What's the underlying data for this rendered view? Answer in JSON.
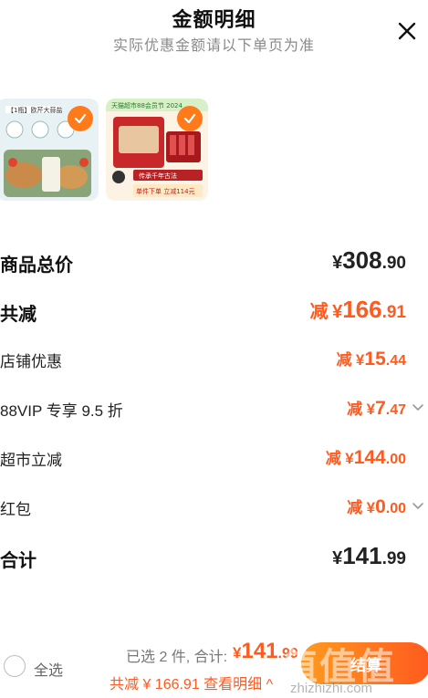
{
  "header": {
    "title": "金额明细",
    "subtitle": "实际优惠金额请以下单页为准"
  },
  "products": [
    {
      "name": "【1瓶】欧芹大蒜盐",
      "selected": true
    },
    {
      "name": "天猫超市88会员节 2024",
      "banner_text": "传承千年古法",
      "offer_text": "单件下单 立减114元",
      "selected": true
    }
  ],
  "breakdown": {
    "goods_total": {
      "label": "商品总价",
      "symbol": "¥",
      "int": "308",
      "dec": ".90"
    },
    "total_discount": {
      "label": "共减",
      "prefix": "减",
      "symbol": "¥",
      "int": "166",
      "dec": ".91"
    },
    "store_discount": {
      "label": "店铺优惠",
      "prefix": "减",
      "symbol": "¥",
      "int": "15",
      "dec": ".44"
    },
    "vip_discount": {
      "label": "88VIP 专享 9.5 折",
      "prefix": "减",
      "symbol": "¥",
      "int": "7",
      "dec": ".47"
    },
    "supermarket_discount": {
      "label": "超市立减",
      "prefix": "减",
      "symbol": "¥",
      "int": "144",
      "dec": ".00"
    },
    "red_packet": {
      "label": "红包",
      "prefix": "减",
      "symbol": "¥",
      "int": "0",
      "dec": ".00"
    },
    "grand_total": {
      "label": "合计",
      "symbol": "¥",
      "int": "141",
      "dec": ".99"
    }
  },
  "footer": {
    "select_all": "全选",
    "selected_info": "已选 2 件, 合计:",
    "total_symbol": "¥",
    "total_int": "141",
    "total_dec": ".99",
    "discount_text": "共减 ¥ 166.91  查看明细 ^",
    "checkout_label": "结算",
    "watermark": "值值值",
    "watermark_sub": "zhizhizhi.com"
  },
  "colors": {
    "accent": "#ff5a1f",
    "check": "#ff7a1a",
    "muted": "#8a8a8a"
  },
  "icons": [
    "close-icon",
    "check-icon",
    "chevron-down-icon"
  ]
}
